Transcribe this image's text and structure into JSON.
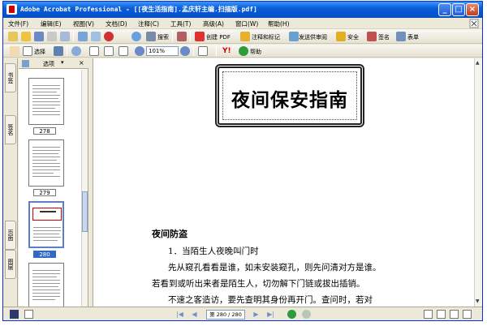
{
  "window": {
    "title": "Adobe Acrobat Professional - [[夜生活指南].孟庆轩主编.扫描版.pdf]",
    "controls": [
      "minimize",
      "maximize",
      "close"
    ]
  },
  "menu": {
    "items": [
      "文件(F)",
      "编辑(E)",
      "视图(V)",
      "文档(D)",
      "注释(C)",
      "工具(T)",
      "高级(A)",
      "窗口(W)",
      "帮助(H)"
    ]
  },
  "toolbar1": {
    "open_label": "",
    "email_label": "",
    "print_label": "",
    "search_label": "搜索",
    "create_pdf_label": "创建 PDF",
    "comment_label": "注释和标记",
    "review_label": "发送供审阅",
    "secure_label": "安全",
    "sign_label": "签名",
    "forms_label": "表单"
  },
  "toolbar2": {
    "select_label": "选择",
    "zoom_value": "101%",
    "help_label": "帮助"
  },
  "left_tabs": [
    "书签",
    "签名",
    "页面",
    "图层"
  ],
  "panel": {
    "options_label": "选项",
    "thumbnails": [
      {
        "label": "278",
        "selected": false
      },
      {
        "label": "279",
        "selected": false
      },
      {
        "label": "280",
        "selected": true
      }
    ]
  },
  "document": {
    "title": "夜间保安指南",
    "section_heading": "夜间防盗",
    "paragraphs": [
      "1．当陌生人夜晚叫门时",
      "先从窥孔看看是谁，如未安装窥孔，则先问清对方是谁。",
      "若看到或听出来者是陌生人，切勿解下门链或拔出插销。",
      "不速之客造访，要先查明其身份再开门。查问时，若对"
    ]
  },
  "status": {
    "page_value": "第 280 / 280 页"
  },
  "colors": {
    "titlebar": "#0a5fd8",
    "selection": "#316ac5",
    "thumb_highlight": "#cc0000"
  }
}
